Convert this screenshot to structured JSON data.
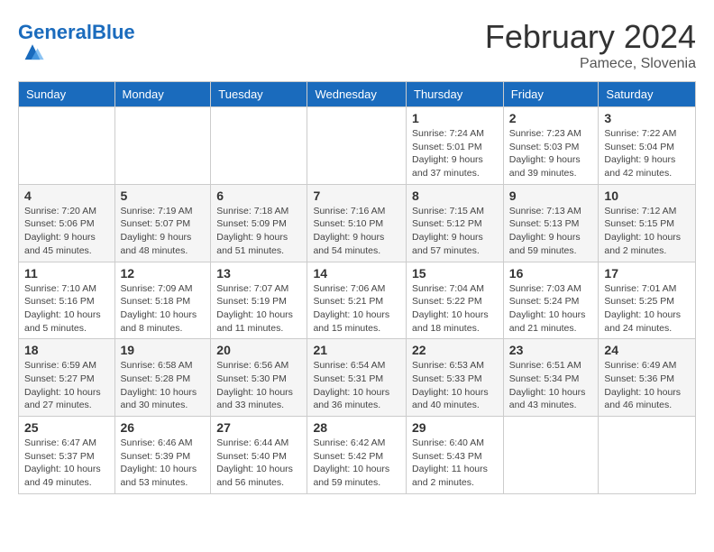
{
  "header": {
    "logo_general": "General",
    "logo_blue": "Blue",
    "month": "February 2024",
    "location": "Pamece, Slovenia"
  },
  "weekdays": [
    "Sunday",
    "Monday",
    "Tuesday",
    "Wednesday",
    "Thursday",
    "Friday",
    "Saturday"
  ],
  "weeks": [
    [
      {
        "day": "",
        "sunrise": "",
        "sunset": "",
        "daylight": ""
      },
      {
        "day": "",
        "sunrise": "",
        "sunset": "",
        "daylight": ""
      },
      {
        "day": "",
        "sunrise": "",
        "sunset": "",
        "daylight": ""
      },
      {
        "day": "",
        "sunrise": "",
        "sunset": "",
        "daylight": ""
      },
      {
        "day": "1",
        "sunrise": "Sunrise: 7:24 AM",
        "sunset": "Sunset: 5:01 PM",
        "daylight": "Daylight: 9 hours and 37 minutes."
      },
      {
        "day": "2",
        "sunrise": "Sunrise: 7:23 AM",
        "sunset": "Sunset: 5:03 PM",
        "daylight": "Daylight: 9 hours and 39 minutes."
      },
      {
        "day": "3",
        "sunrise": "Sunrise: 7:22 AM",
        "sunset": "Sunset: 5:04 PM",
        "daylight": "Daylight: 9 hours and 42 minutes."
      }
    ],
    [
      {
        "day": "4",
        "sunrise": "Sunrise: 7:20 AM",
        "sunset": "Sunset: 5:06 PM",
        "daylight": "Daylight: 9 hours and 45 minutes."
      },
      {
        "day": "5",
        "sunrise": "Sunrise: 7:19 AM",
        "sunset": "Sunset: 5:07 PM",
        "daylight": "Daylight: 9 hours and 48 minutes."
      },
      {
        "day": "6",
        "sunrise": "Sunrise: 7:18 AM",
        "sunset": "Sunset: 5:09 PM",
        "daylight": "Daylight: 9 hours and 51 minutes."
      },
      {
        "day": "7",
        "sunrise": "Sunrise: 7:16 AM",
        "sunset": "Sunset: 5:10 PM",
        "daylight": "Daylight: 9 hours and 54 minutes."
      },
      {
        "day": "8",
        "sunrise": "Sunrise: 7:15 AM",
        "sunset": "Sunset: 5:12 PM",
        "daylight": "Daylight: 9 hours and 57 minutes."
      },
      {
        "day": "9",
        "sunrise": "Sunrise: 7:13 AM",
        "sunset": "Sunset: 5:13 PM",
        "daylight": "Daylight: 9 hours and 59 minutes."
      },
      {
        "day": "10",
        "sunrise": "Sunrise: 7:12 AM",
        "sunset": "Sunset: 5:15 PM",
        "daylight": "Daylight: 10 hours and 2 minutes."
      }
    ],
    [
      {
        "day": "11",
        "sunrise": "Sunrise: 7:10 AM",
        "sunset": "Sunset: 5:16 PM",
        "daylight": "Daylight: 10 hours and 5 minutes."
      },
      {
        "day": "12",
        "sunrise": "Sunrise: 7:09 AM",
        "sunset": "Sunset: 5:18 PM",
        "daylight": "Daylight: 10 hours and 8 minutes."
      },
      {
        "day": "13",
        "sunrise": "Sunrise: 7:07 AM",
        "sunset": "Sunset: 5:19 PM",
        "daylight": "Daylight: 10 hours and 11 minutes."
      },
      {
        "day": "14",
        "sunrise": "Sunrise: 7:06 AM",
        "sunset": "Sunset: 5:21 PM",
        "daylight": "Daylight: 10 hours and 15 minutes."
      },
      {
        "day": "15",
        "sunrise": "Sunrise: 7:04 AM",
        "sunset": "Sunset: 5:22 PM",
        "daylight": "Daylight: 10 hours and 18 minutes."
      },
      {
        "day": "16",
        "sunrise": "Sunrise: 7:03 AM",
        "sunset": "Sunset: 5:24 PM",
        "daylight": "Daylight: 10 hours and 21 minutes."
      },
      {
        "day": "17",
        "sunrise": "Sunrise: 7:01 AM",
        "sunset": "Sunset: 5:25 PM",
        "daylight": "Daylight: 10 hours and 24 minutes."
      }
    ],
    [
      {
        "day": "18",
        "sunrise": "Sunrise: 6:59 AM",
        "sunset": "Sunset: 5:27 PM",
        "daylight": "Daylight: 10 hours and 27 minutes."
      },
      {
        "day": "19",
        "sunrise": "Sunrise: 6:58 AM",
        "sunset": "Sunset: 5:28 PM",
        "daylight": "Daylight: 10 hours and 30 minutes."
      },
      {
        "day": "20",
        "sunrise": "Sunrise: 6:56 AM",
        "sunset": "Sunset: 5:30 PM",
        "daylight": "Daylight: 10 hours and 33 minutes."
      },
      {
        "day": "21",
        "sunrise": "Sunrise: 6:54 AM",
        "sunset": "Sunset: 5:31 PM",
        "daylight": "Daylight: 10 hours and 36 minutes."
      },
      {
        "day": "22",
        "sunrise": "Sunrise: 6:53 AM",
        "sunset": "Sunset: 5:33 PM",
        "daylight": "Daylight: 10 hours and 40 minutes."
      },
      {
        "day": "23",
        "sunrise": "Sunrise: 6:51 AM",
        "sunset": "Sunset: 5:34 PM",
        "daylight": "Daylight: 10 hours and 43 minutes."
      },
      {
        "day": "24",
        "sunrise": "Sunrise: 6:49 AM",
        "sunset": "Sunset: 5:36 PM",
        "daylight": "Daylight: 10 hours and 46 minutes."
      }
    ],
    [
      {
        "day": "25",
        "sunrise": "Sunrise: 6:47 AM",
        "sunset": "Sunset: 5:37 PM",
        "daylight": "Daylight: 10 hours and 49 minutes."
      },
      {
        "day": "26",
        "sunrise": "Sunrise: 6:46 AM",
        "sunset": "Sunset: 5:39 PM",
        "daylight": "Daylight: 10 hours and 53 minutes."
      },
      {
        "day": "27",
        "sunrise": "Sunrise: 6:44 AM",
        "sunset": "Sunset: 5:40 PM",
        "daylight": "Daylight: 10 hours and 56 minutes."
      },
      {
        "day": "28",
        "sunrise": "Sunrise: 6:42 AM",
        "sunset": "Sunset: 5:42 PM",
        "daylight": "Daylight: 10 hours and 59 minutes."
      },
      {
        "day": "29",
        "sunrise": "Sunrise: 6:40 AM",
        "sunset": "Sunset: 5:43 PM",
        "daylight": "Daylight: 11 hours and 2 minutes."
      },
      {
        "day": "",
        "sunrise": "",
        "sunset": "",
        "daylight": ""
      },
      {
        "day": "",
        "sunrise": "",
        "sunset": "",
        "daylight": ""
      }
    ]
  ]
}
